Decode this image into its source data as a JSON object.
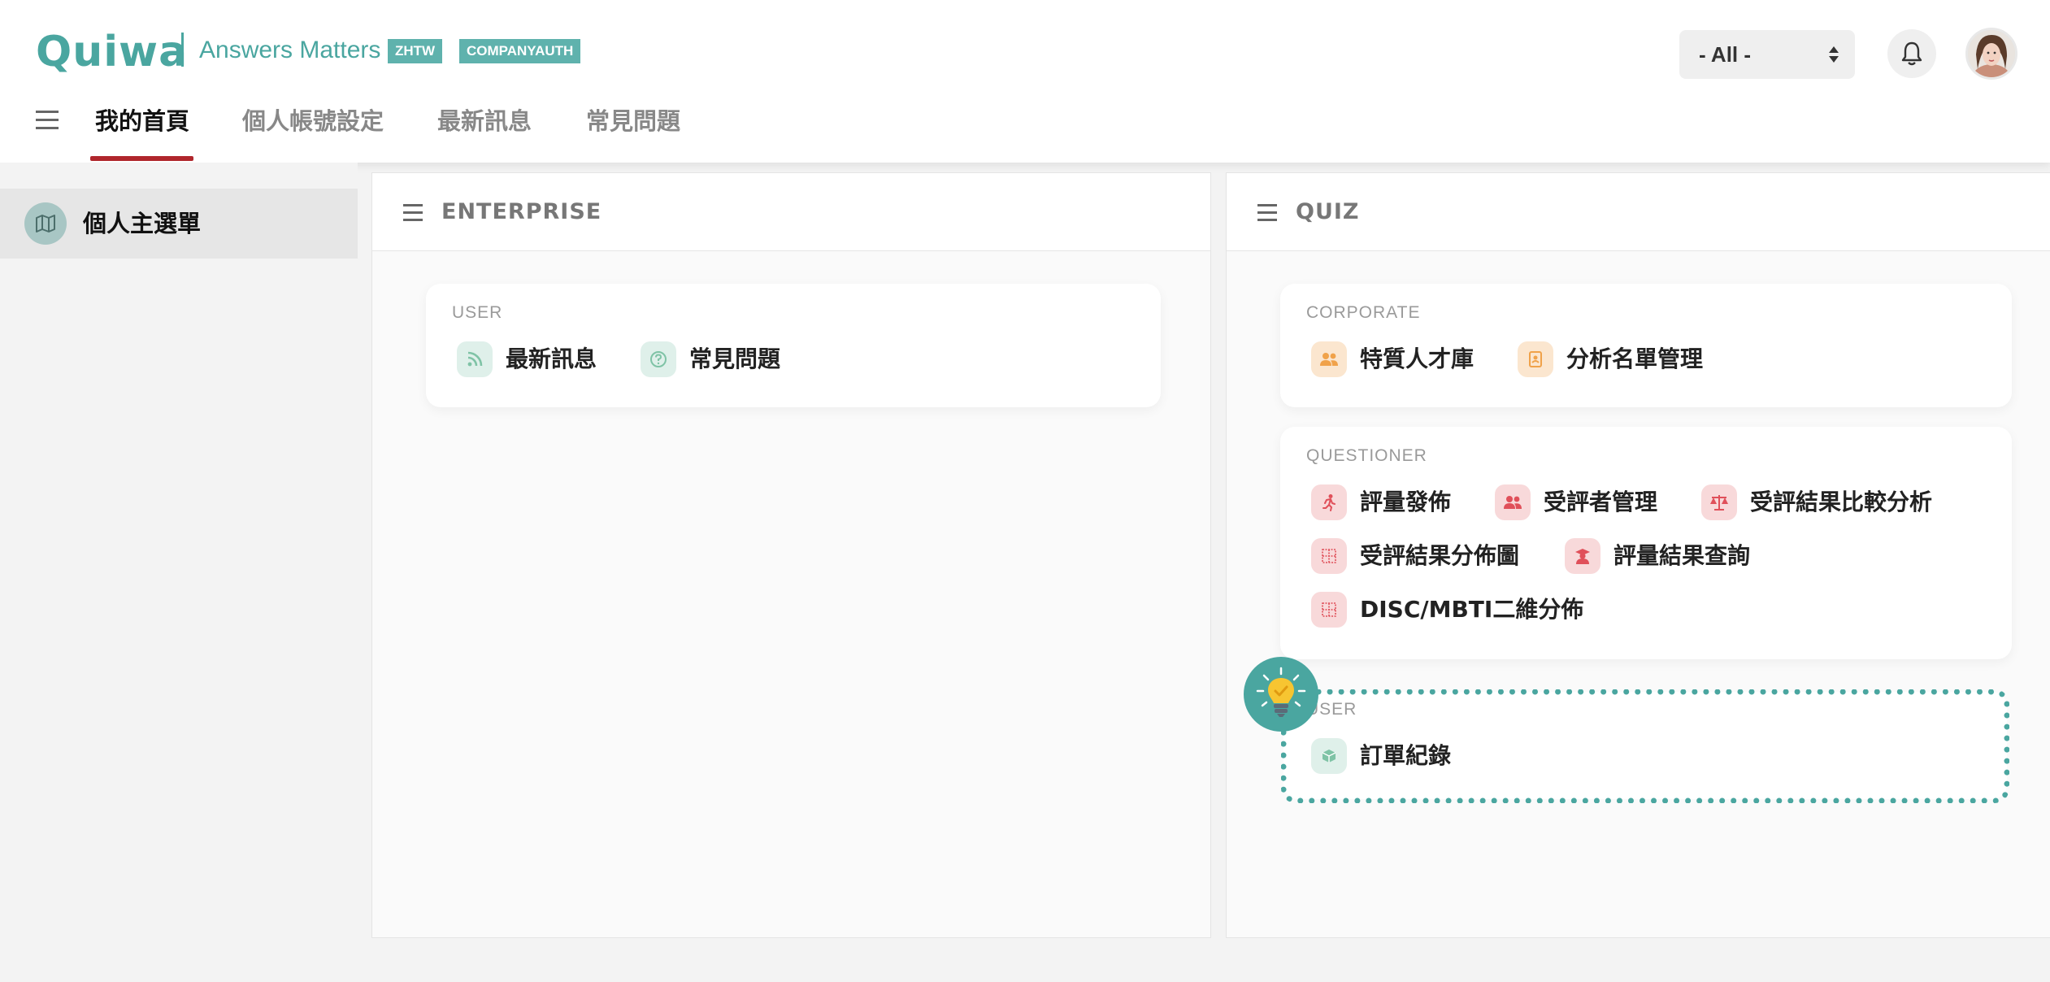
{
  "header": {
    "logo": "Quiwa",
    "tagline": "Answers Matters",
    "badges": [
      "ZHTW",
      "COMPANYAUTH"
    ],
    "filter": {
      "selected": "- All -"
    },
    "icons": {
      "notifications": "bell-icon",
      "avatar": "user-avatar"
    }
  },
  "nav": {
    "tabs": [
      {
        "label": "我的首頁",
        "active": true
      },
      {
        "label": "個人帳號設定",
        "active": false
      },
      {
        "label": "最新訊息",
        "active": false
      },
      {
        "label": "常見問題",
        "active": false
      }
    ]
  },
  "sidebar": {
    "items": [
      {
        "label": "個人主選單",
        "icon": "map-icon",
        "selected": true
      }
    ]
  },
  "panels": {
    "enterprise": {
      "title": "ENTERPRISE",
      "sections": [
        {
          "label": "USER",
          "items": [
            {
              "label": "最新訊息",
              "icon": "rss-icon",
              "color": "#7fc3a6"
            },
            {
              "label": "常見問題",
              "icon": "help-icon",
              "color": "#7fc3a6"
            }
          ]
        }
      ]
    },
    "quiz": {
      "title": "QUIZ",
      "sections": [
        {
          "label": "CORPORATE",
          "items": [
            {
              "label": "特質人才庫",
              "icon": "users-icon",
              "color": "#f0a24a"
            },
            {
              "label": "分析名單管理",
              "icon": "contact-book-icon",
              "color": "#f0a24a"
            }
          ]
        },
        {
          "label": "QUESTIONER",
          "items": [
            {
              "label": "評量發佈",
              "icon": "running-icon",
              "color": "#e0505a"
            },
            {
              "label": "受評者管理",
              "icon": "users-icon",
              "color": "#e0505a"
            },
            {
              "label": "受評結果比較分析",
              "icon": "balance-scale-icon",
              "color": "#e0505a"
            },
            {
              "label": "受評結果分佈圖",
              "icon": "grid-chart-icon",
              "color": "#e0505a"
            },
            {
              "label": "評量結果查詢",
              "icon": "graduate-icon",
              "color": "#e0505a"
            },
            {
              "label": "DISC/MBTI二維分佈",
              "icon": "grid-chart-icon",
              "color": "#e0505a"
            }
          ]
        },
        {
          "label": "USER",
          "items": [
            {
              "label": "訂單紀錄",
              "icon": "box-icon",
              "color": "#7fc3a6"
            }
          ]
        }
      ]
    }
  },
  "highlight": {
    "icon": "lightbulb-icon",
    "accent": "#4aa6a0"
  },
  "colors": {
    "brand": "#4aa6a0",
    "active_tab_underline": "#b0262c"
  }
}
